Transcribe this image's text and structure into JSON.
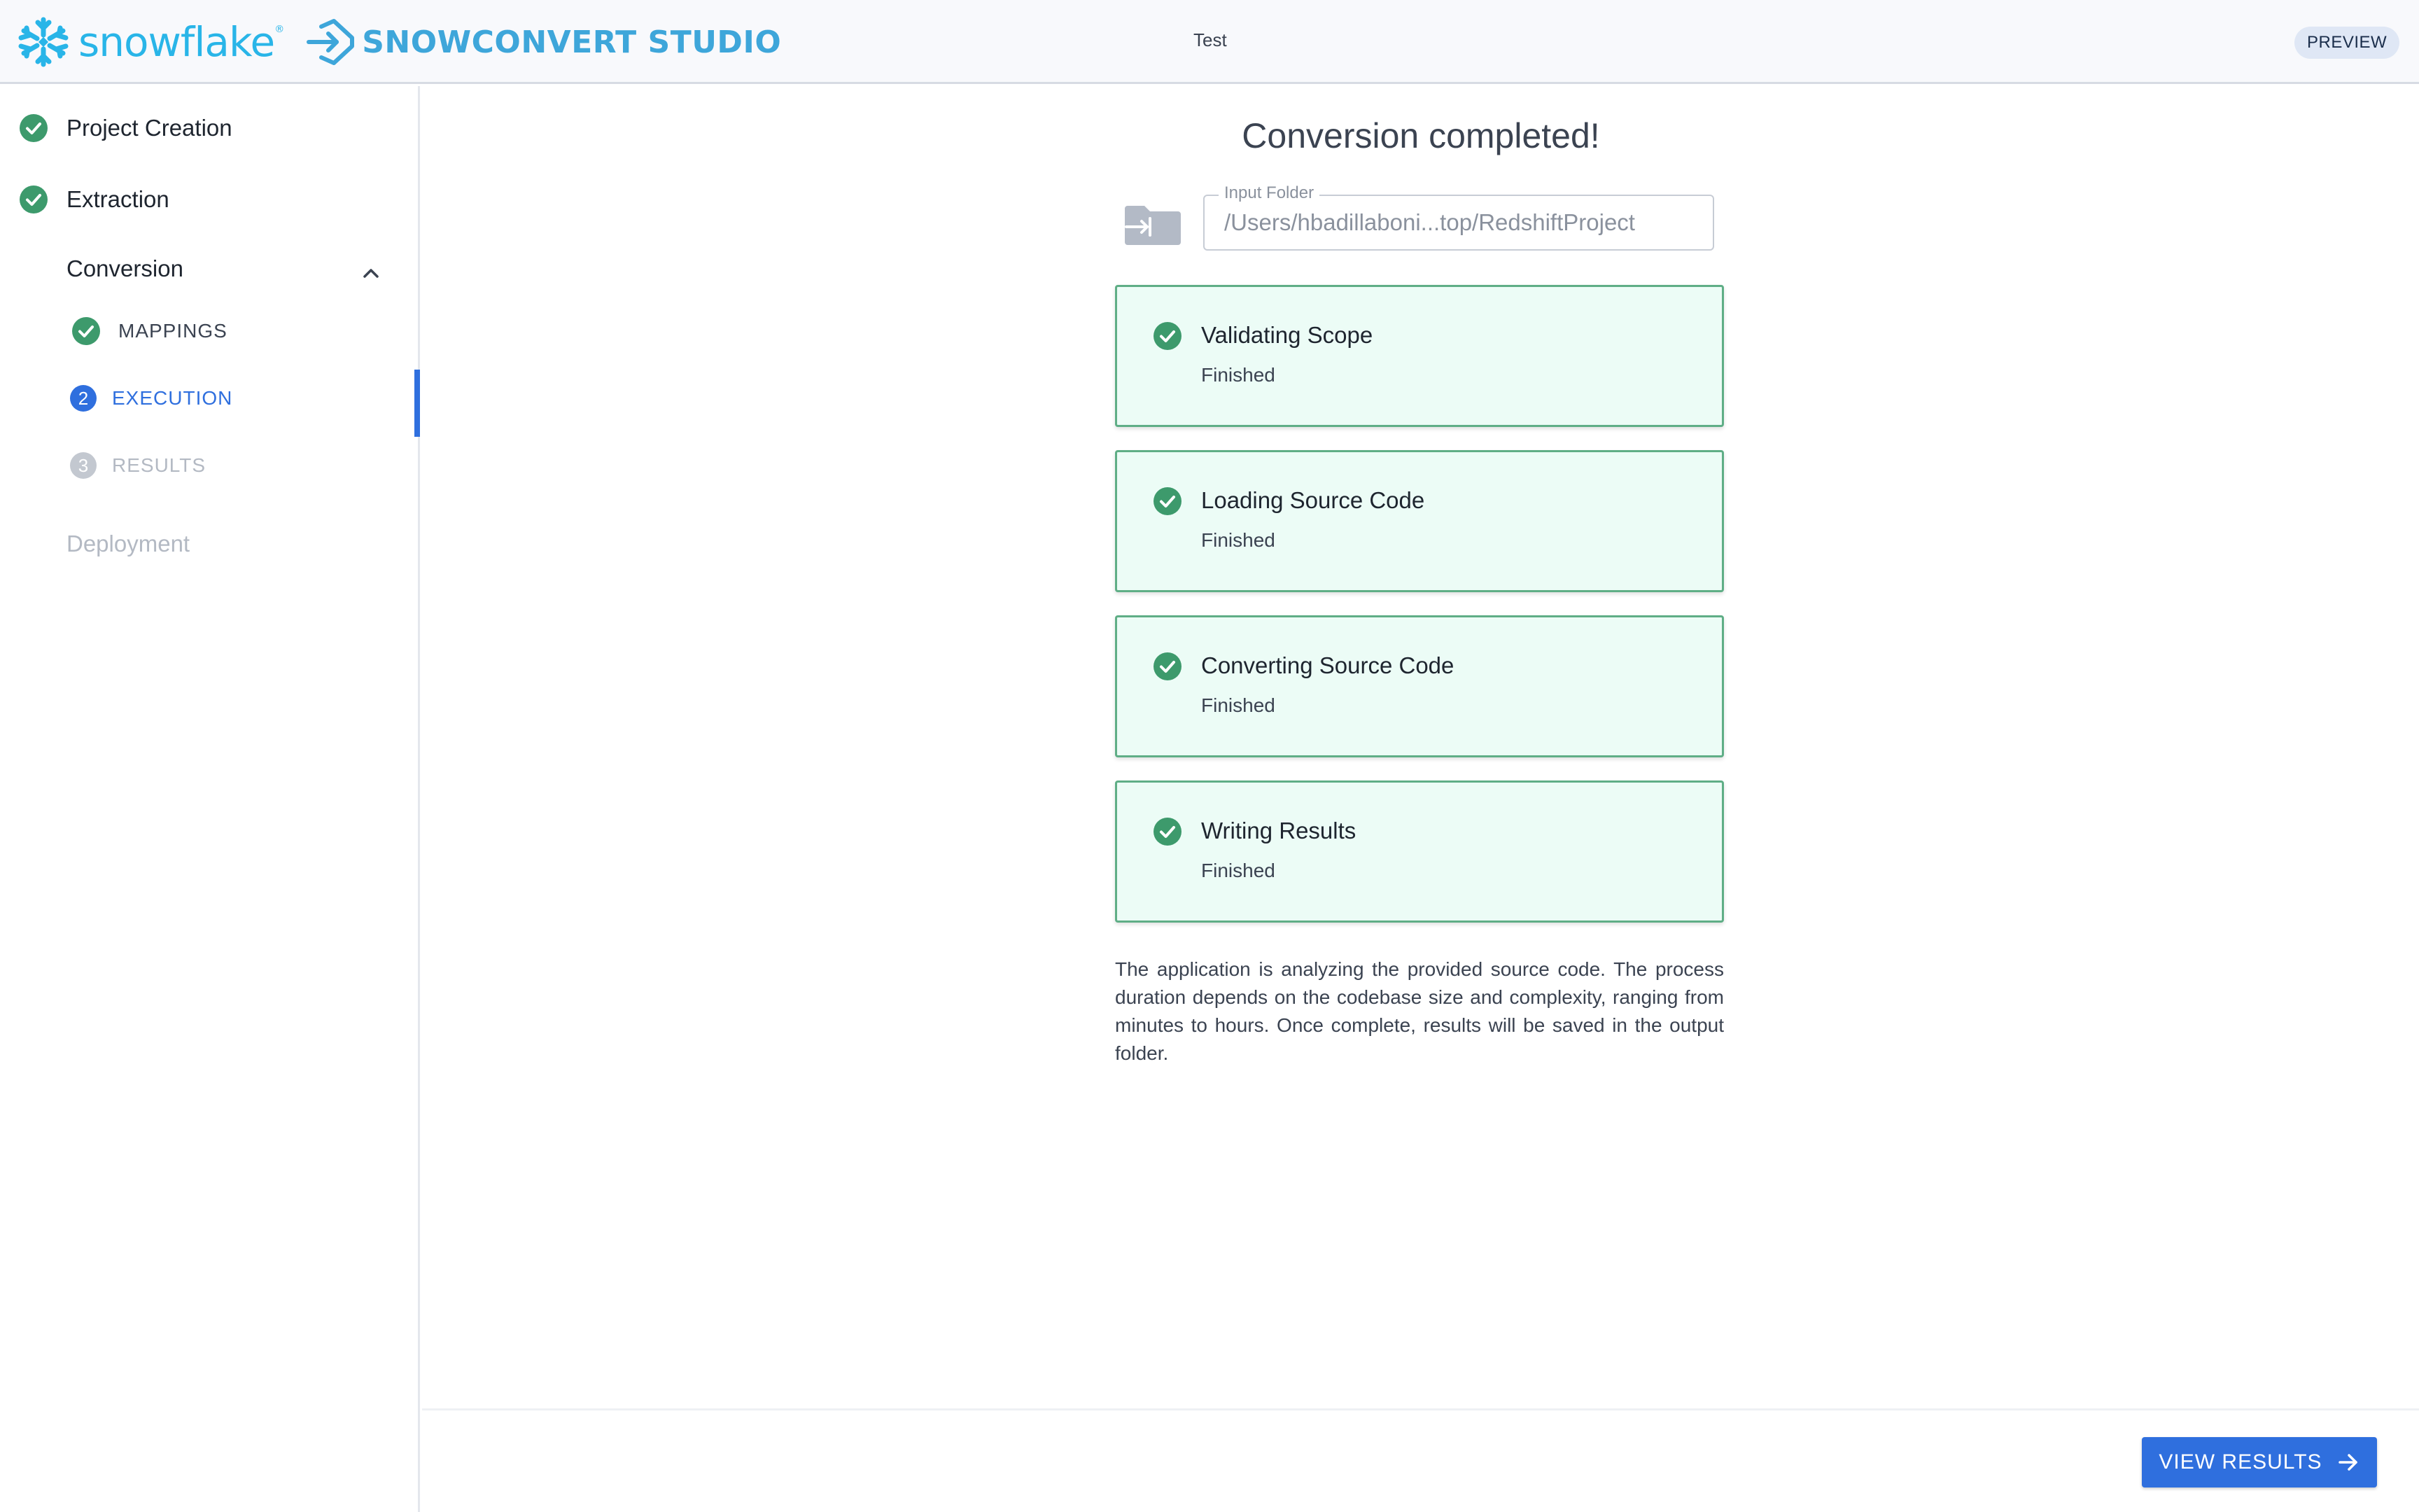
{
  "header": {
    "brand_name": "snowflake",
    "brand_mark": "®",
    "product_name": "SNOWCONVERT STUDIO",
    "project_name": "Test",
    "badge": "PREVIEW"
  },
  "sidebar": {
    "steps": [
      {
        "label": "Project Creation",
        "status": "done"
      },
      {
        "label": "Extraction",
        "status": "done"
      },
      {
        "label": "Conversion",
        "status": "expanded"
      },
      {
        "label": "Deployment",
        "status": "disabled"
      }
    ],
    "substeps": [
      {
        "label": "MAPPINGS",
        "status": "done"
      },
      {
        "label": "EXECUTION",
        "number": "2",
        "status": "active"
      },
      {
        "label": "RESULTS",
        "number": "3",
        "status": "disabled"
      }
    ]
  },
  "main": {
    "title": "Conversion completed!",
    "input_folder": {
      "label": "Input Folder",
      "value": "/Users/hbadillaboni...top/RedshiftProject"
    },
    "steps": [
      {
        "title": "Validating Scope",
        "status": "Finished"
      },
      {
        "title": "Loading Source Code",
        "status": "Finished"
      },
      {
        "title": "Converting Source Code",
        "status": "Finished"
      },
      {
        "title": "Writing Results",
        "status": "Finished"
      }
    ],
    "description": "The application is analyzing the provided source code. The process duration depends on the codebase size and complexity, ranging from minutes to hours. Once complete, results will be saved in the output folder."
  },
  "footer": {
    "view_results_label": "VIEW RESULTS"
  },
  "colors": {
    "accent": "#2f6fde",
    "success": "#3d9a6c",
    "card_bg": "#ecfcf6",
    "brand": "#29b5e8"
  }
}
